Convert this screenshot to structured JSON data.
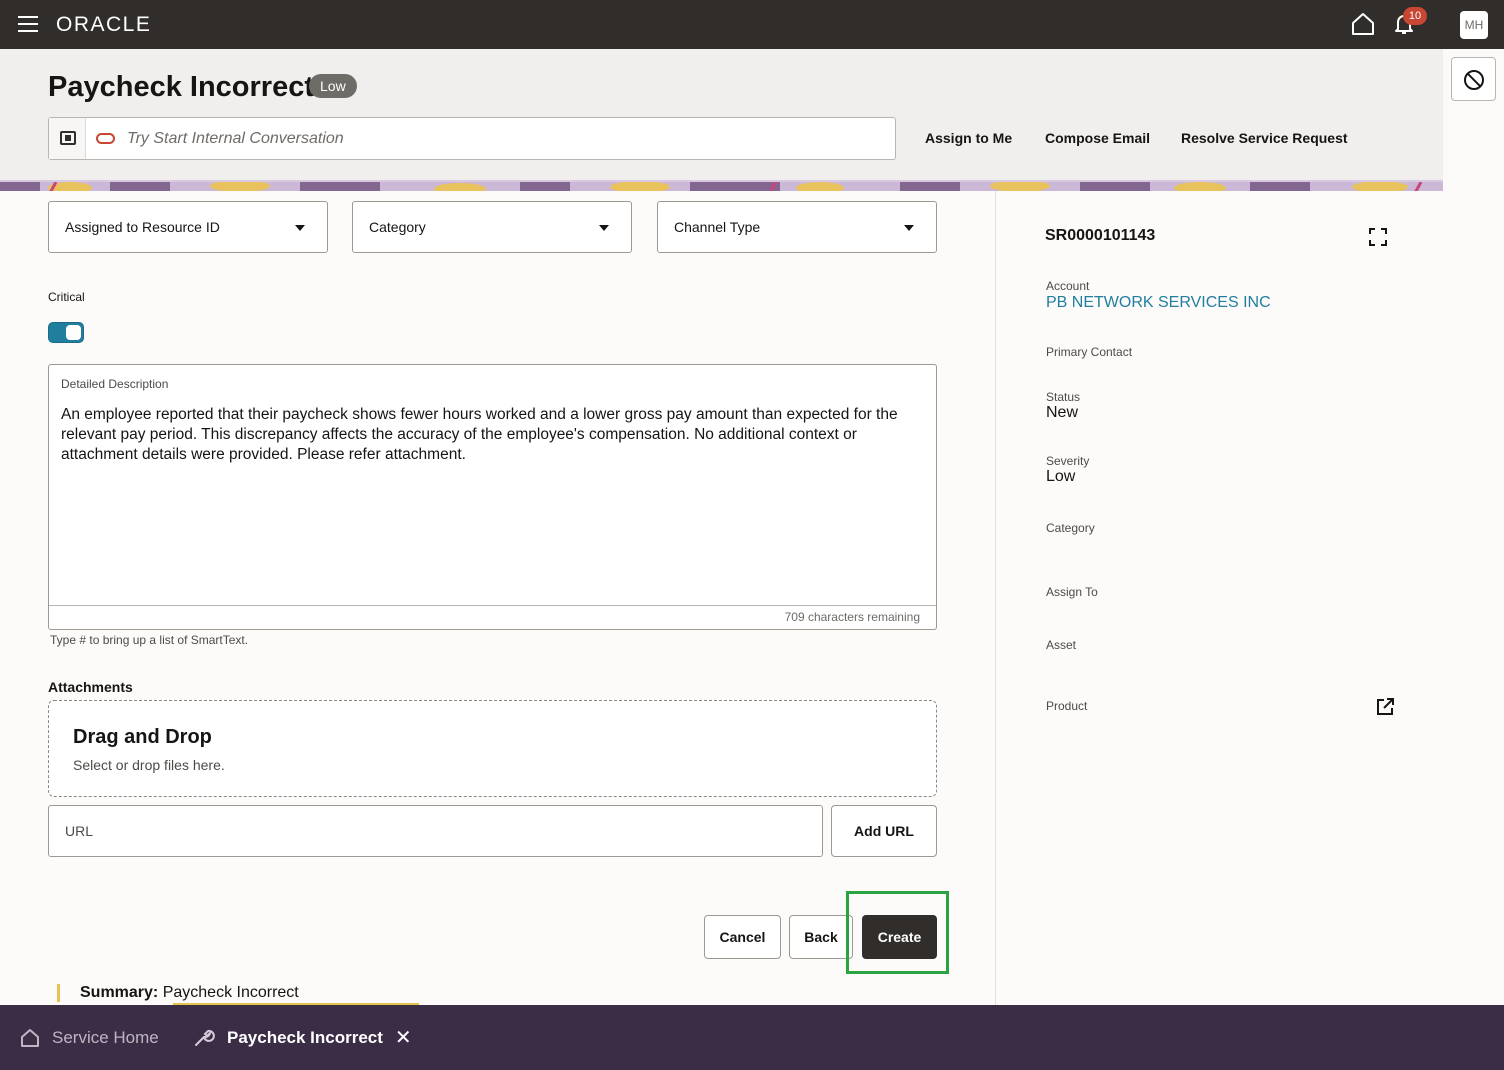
{
  "app": {
    "brand": "ORACLE",
    "notification_count": "10",
    "user_initials": "MH"
  },
  "header": {
    "title": "Paycheck Incorrect",
    "priority_badge": "Low",
    "conversation_placeholder": "Try Start Internal Conversation",
    "actions": {
      "assign_to_me": "Assign to Me",
      "compose_email": "Compose Email",
      "resolve": "Resolve Service Request"
    }
  },
  "form": {
    "selects": {
      "assigned_resource": "Assigned to Resource ID",
      "category": "Category",
      "channel_type": "Channel Type"
    },
    "critical_label": "Critical",
    "critical_on": true,
    "description_label": "Detailed Description",
    "description_text": "An employee reported that their paycheck shows fewer hours worked and a lower gross pay amount than expected for the relevant pay period. This discrepancy affects the accuracy of the employee's compensation. No additional context or attachment details were provided. Please refer attachment.",
    "chars_remaining": "709 characters remaining",
    "smarttext_hint": "Type # to bring up a list of SmartText.",
    "attachments_label": "Attachments",
    "dropzone_title": "Drag and Drop",
    "dropzone_sub": "Select or drop files here.",
    "url_placeholder": "URL",
    "add_url": "Add URL",
    "buttons": {
      "cancel": "Cancel",
      "back": "Back",
      "create": "Create"
    },
    "summary_label": "Summary:",
    "summary_value": " Paycheck Incorrect"
  },
  "panel": {
    "sr_number": "SR0000101143",
    "account_label": "Account",
    "account_value": "PB NETWORK SERVICES INC",
    "primary_contact_label": "Primary Contact",
    "status_label": "Status",
    "status_value": "New",
    "severity_label": "Severity",
    "severity_value": "Low",
    "category_label": "Category",
    "assign_to_label": "Assign To",
    "asset_label": "Asset",
    "product_label": "Product"
  },
  "tabs": {
    "home": "Service Home",
    "active": "Paycheck Incorrect"
  },
  "colors": {
    "topbar": "#312d2a",
    "accent": "#227e9e",
    "badge": "#c74634",
    "tabbar": "#3c2d47",
    "highlight": "#2ca341"
  }
}
